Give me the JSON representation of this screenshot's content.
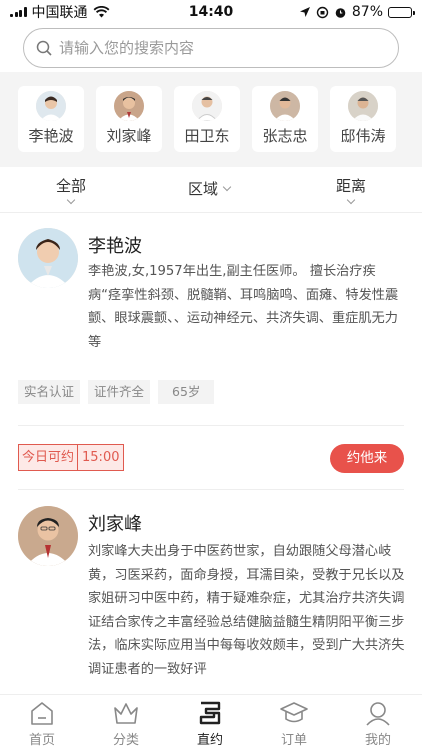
{
  "status_bar": {
    "carrier": "中国联通",
    "time": "14:40",
    "battery": "87%",
    "battery_level": 0.87
  },
  "search": {
    "placeholder": "请输入您的搜索内容"
  },
  "doctor_chips": [
    {
      "name": "李艳波"
    },
    {
      "name": "刘家峰"
    },
    {
      "name": "田卫东"
    },
    {
      "name": "张志忠"
    },
    {
      "name": "邸伟涛"
    }
  ],
  "filters": {
    "all": "全部",
    "region": "区域",
    "distance": "距离"
  },
  "doctors": [
    {
      "name": "李艳波",
      "desc": "李艳波,女,1957年出生,副主任医师。 擅长治疗疾病“痉挛性斜颈、脱髓鞘、耳鸣脑鸣、面瘫、特发性震颤、眼球震颤、、运动神经元、共济失调、重症肌无力等",
      "tags": [
        "实名认证",
        "证件齐全",
        "65岁"
      ],
      "today_label": "今日可约",
      "today_time": "15:00",
      "book_label": "约他来"
    },
    {
      "name": "刘家峰",
      "desc": "刘家峰大夫出身于中医药世家，自幼跟随父母潜心岐黄，习医采药，面命身授，耳濡目染，受教于兄长以及家姐研习中医中药，精于疑难杂症，尤其治疗共济失调证结合家传之丰富经验总结健脑益髓生精阴阳平衡三步法，临床实际应用当中每每收效颇丰，受到广大共济失调证患者的一致好评"
    }
  ],
  "tabs": [
    {
      "label": "首页",
      "icon": "home-icon"
    },
    {
      "label": "分类",
      "icon": "crown-icon"
    },
    {
      "label": "直约",
      "icon": "direct-booking-icon"
    },
    {
      "label": "订单",
      "icon": "graduation-cap-icon"
    },
    {
      "label": "我的",
      "icon": "user-icon"
    }
  ],
  "colors": {
    "accent": "#e8524b",
    "tag_bg": "#f3f3f3",
    "chip_band_bg": "#f4f4f4"
  }
}
